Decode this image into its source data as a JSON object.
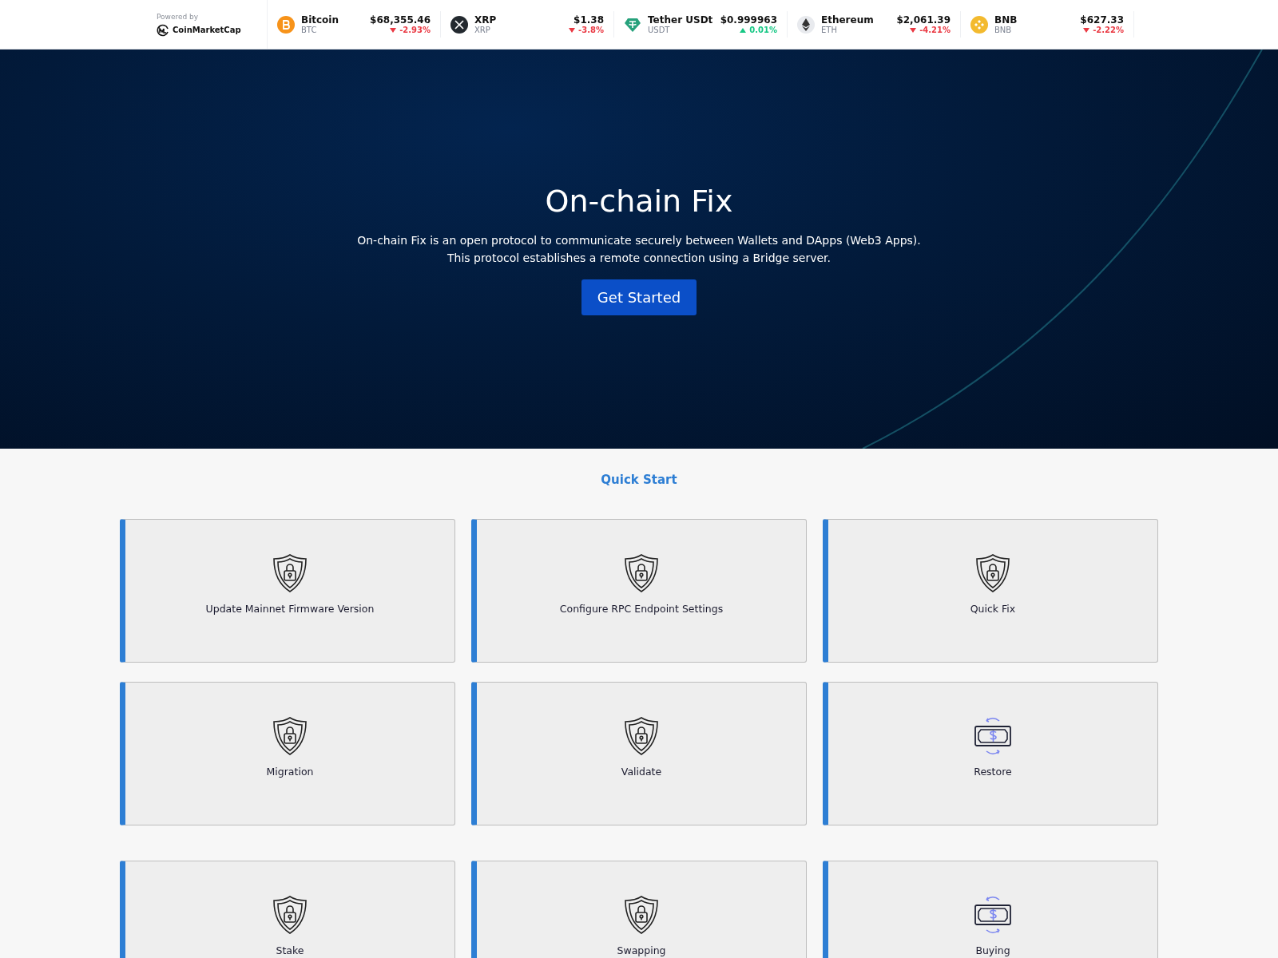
{
  "ticker": {
    "powered_by": "Powered by",
    "brand": "CoinMarketCap",
    "coins": [
      {
        "name": "Bitcoin",
        "symbol": "BTC",
        "price": "$68,355.46",
        "change": "-2.93%",
        "up": false,
        "kind": "bitcoin",
        "color": "#f7931a"
      },
      {
        "name": "XRP",
        "symbol": "XRP",
        "price": "$1.38",
        "change": "-3.8%",
        "up": false,
        "kind": "xrp",
        "color": "#23292f"
      },
      {
        "name": "Tether USDt",
        "symbol": "USDT",
        "price": "$0.999963",
        "change": "0.01%",
        "up": true,
        "kind": "tether",
        "color": "#26a17b"
      },
      {
        "name": "Ethereum",
        "symbol": "ETH",
        "price": "$2,061.39",
        "change": "-4.21%",
        "up": false,
        "kind": "ethereum",
        "color": "#e8eaee"
      },
      {
        "name": "BNB",
        "symbol": "BNB",
        "price": "$627.33",
        "change": "-2.22%",
        "up": false,
        "kind": "bnb",
        "color": "#f3ba2f"
      }
    ]
  },
  "hero": {
    "title": "On-chain Fix",
    "lines": [
      "On-chain Fix is an open protocol to communicate securely between Wallets and DApps (Web3 Apps).",
      "This protocol establishes a remote connection using a Bridge server."
    ],
    "button": "Get Started"
  },
  "quick_start": {
    "title": "Quick Start",
    "rows": [
      [
        {
          "label": "Update Mainnet Firmware Version",
          "kind": "shield"
        },
        {
          "label": "Configure RPC Endpoint Settings",
          "kind": "shield"
        },
        {
          "label": "Quick Fix",
          "kind": "shield"
        }
      ],
      [
        {
          "label": "Migration",
          "kind": "shield"
        },
        {
          "label": "Validate",
          "kind": "shield"
        },
        {
          "label": "Restore",
          "kind": "money"
        }
      ],
      [
        {
          "label": "Stake",
          "kind": "shield"
        },
        {
          "label": "Swapping",
          "kind": "shield"
        },
        {
          "label": "Buying",
          "kind": "money"
        }
      ]
    ]
  }
}
